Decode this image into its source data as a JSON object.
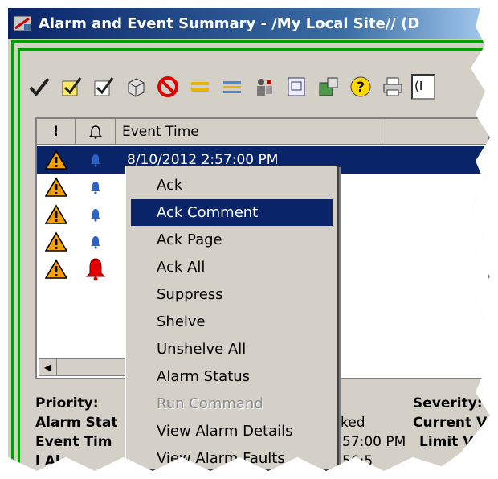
{
  "window": {
    "title": "Alarm and Event Summary - /My Local Site// (D"
  },
  "toolbar": {
    "icons": [
      "checkmark-icon",
      "ack-check-icon",
      "ack-comment-icon",
      "cube-icon",
      "no-entry-icon",
      "equals-icon",
      "filter-lines-icon",
      "people-icon",
      "page-icon",
      "box-gear-icon",
      "help-icon",
      "print-icon"
    ],
    "field_value": "(I"
  },
  "list": {
    "columns": [
      "!",
      "🔔",
      "Event Time"
    ],
    "rows": [
      {
        "time": "8/10/2012 2:57:00 PM",
        "selected": true,
        "bell": "blue"
      },
      {
        "time": "",
        "selected": false,
        "bell": "blue"
      },
      {
        "time": "",
        "selected": false,
        "bell": "blue"
      },
      {
        "time": "",
        "selected": false,
        "bell": "blue"
      },
      {
        "time": "",
        "selected": false,
        "bell": "red"
      }
    ]
  },
  "details": {
    "priority_label": "Priority:",
    "alarm_status_label": "Alarm Stat",
    "event_time_label": "Event Tim",
    "partial_label": "l  Al",
    "severity_label": "Severity:",
    "current_value_label": "Current Va",
    "limit_value_label": "Limit V",
    "status_value": "ked",
    "time_value": "57:00 PM",
    "last_value": "56:5"
  },
  "context_menu": {
    "items": [
      {
        "label": "Ack",
        "state": "normal"
      },
      {
        "label": "Ack Comment",
        "state": "highlighted"
      },
      {
        "label": "Ack Page",
        "state": "normal"
      },
      {
        "label": "Ack All",
        "state": "normal"
      },
      {
        "label": "Suppress",
        "state": "normal"
      },
      {
        "label": "Shelve",
        "state": "normal"
      },
      {
        "label": "Unshelve All",
        "state": "normal"
      },
      {
        "label": "Alarm Status",
        "state": "normal"
      },
      {
        "label": "Run Command",
        "state": "disabled"
      },
      {
        "label": "View Alarm Details",
        "state": "normal"
      },
      {
        "label": "View Alarm Faults",
        "state": "normal"
      }
    ]
  },
  "colors": {
    "selection": "#0a246a",
    "frame_green": "#00a000",
    "face": "#d4d0c8"
  }
}
